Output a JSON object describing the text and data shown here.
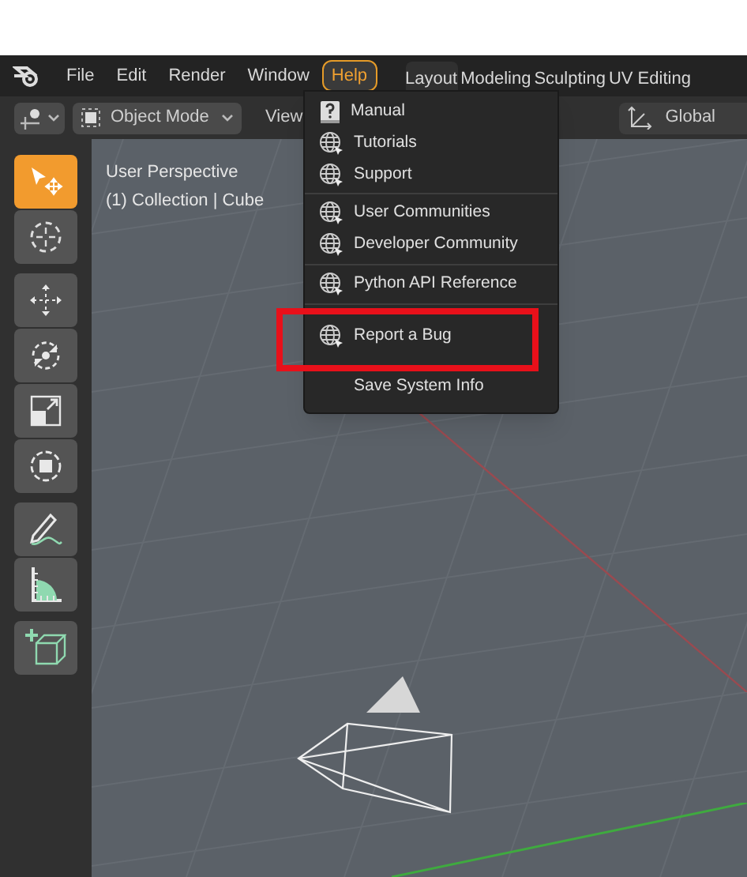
{
  "menu_bar": {
    "items": [
      {
        "label": "File",
        "open": false
      },
      {
        "label": "Edit",
        "open": false
      },
      {
        "label": "Render",
        "open": false
      },
      {
        "label": "Window",
        "open": false
      },
      {
        "label": "Help",
        "open": true
      }
    ],
    "workspace_tabs": [
      {
        "label": "Layout",
        "selected": true
      },
      {
        "label": "Modeling",
        "selected": false
      },
      {
        "label": "Sculpting",
        "selected": false
      },
      {
        "label": "UV Editing",
        "selected": false
      }
    ]
  },
  "header": {
    "mode": "Object Mode",
    "view": "View",
    "orientation": "Global"
  },
  "help_menu": {
    "sections": [
      [
        {
          "kind": "book",
          "label": "Manual"
        },
        {
          "kind": "globe",
          "label": "Tutorials"
        },
        {
          "kind": "globe",
          "label": "Support"
        }
      ],
      [
        {
          "kind": "globe",
          "label": "User Communities"
        },
        {
          "kind": "globe",
          "label": "Developer Community"
        }
      ],
      [
        {
          "kind": "globe",
          "label": "Python API Reference"
        }
      ],
      [
        {
          "kind": "globe",
          "label": "Report a Bug",
          "highlighted": true
        },
        {
          "kind": "plain",
          "label": "Save System Info",
          "highlighted": false
        }
      ]
    ]
  },
  "viewport": {
    "title": "User Perspective",
    "subtitle": "(1) Collection | Cube"
  },
  "toolbar": {
    "groups": [
      [
        {
          "kind": "select",
          "selected": true
        },
        {
          "kind": "cursor",
          "selected": false
        }
      ],
      [
        {
          "kind": "move",
          "selected": false
        },
        {
          "kind": "rotate",
          "selected": false
        },
        {
          "kind": "scale",
          "selected": false
        },
        {
          "kind": "transform",
          "selected": false
        }
      ],
      [
        {
          "kind": "annotate",
          "selected": false
        },
        {
          "kind": "measure",
          "selected": false
        }
      ],
      [
        {
          "kind": "add_cube",
          "selected": false
        }
      ]
    ]
  }
}
